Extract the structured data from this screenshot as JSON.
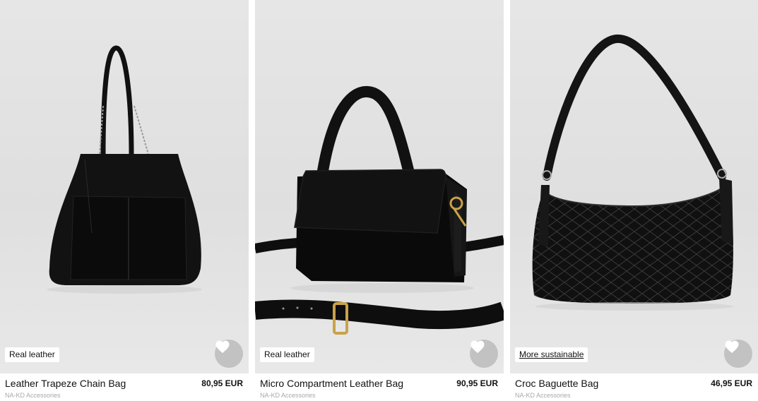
{
  "products": [
    {
      "badge": "Real leather",
      "name": "Leather Trapeze Chain Bag",
      "price": "80,95 EUR",
      "brand": "NA-KD Accessories",
      "image_icon": "tote-bag-icon",
      "wishlist_icon": "heart-icon"
    },
    {
      "badge": "Real leather",
      "name": "Micro Compartment Leather Bag",
      "price": "90,95 EUR",
      "brand": "NA-KD Accessories",
      "image_icon": "crossbody-bag-icon",
      "wishlist_icon": "heart-icon"
    },
    {
      "badge": "More sustainable",
      "name": "Croc Baguette Bag",
      "price": "46,95 EUR",
      "brand": "NA-KD Accessories",
      "image_icon": "baguette-bag-icon",
      "wishlist_icon": "heart-icon"
    }
  ],
  "colors": {
    "badge_bg": "#ffffff",
    "fav_bg": "#c2c2c2",
    "brand_text": "#a8a8a8",
    "image_bg": "#e3e3e3"
  }
}
